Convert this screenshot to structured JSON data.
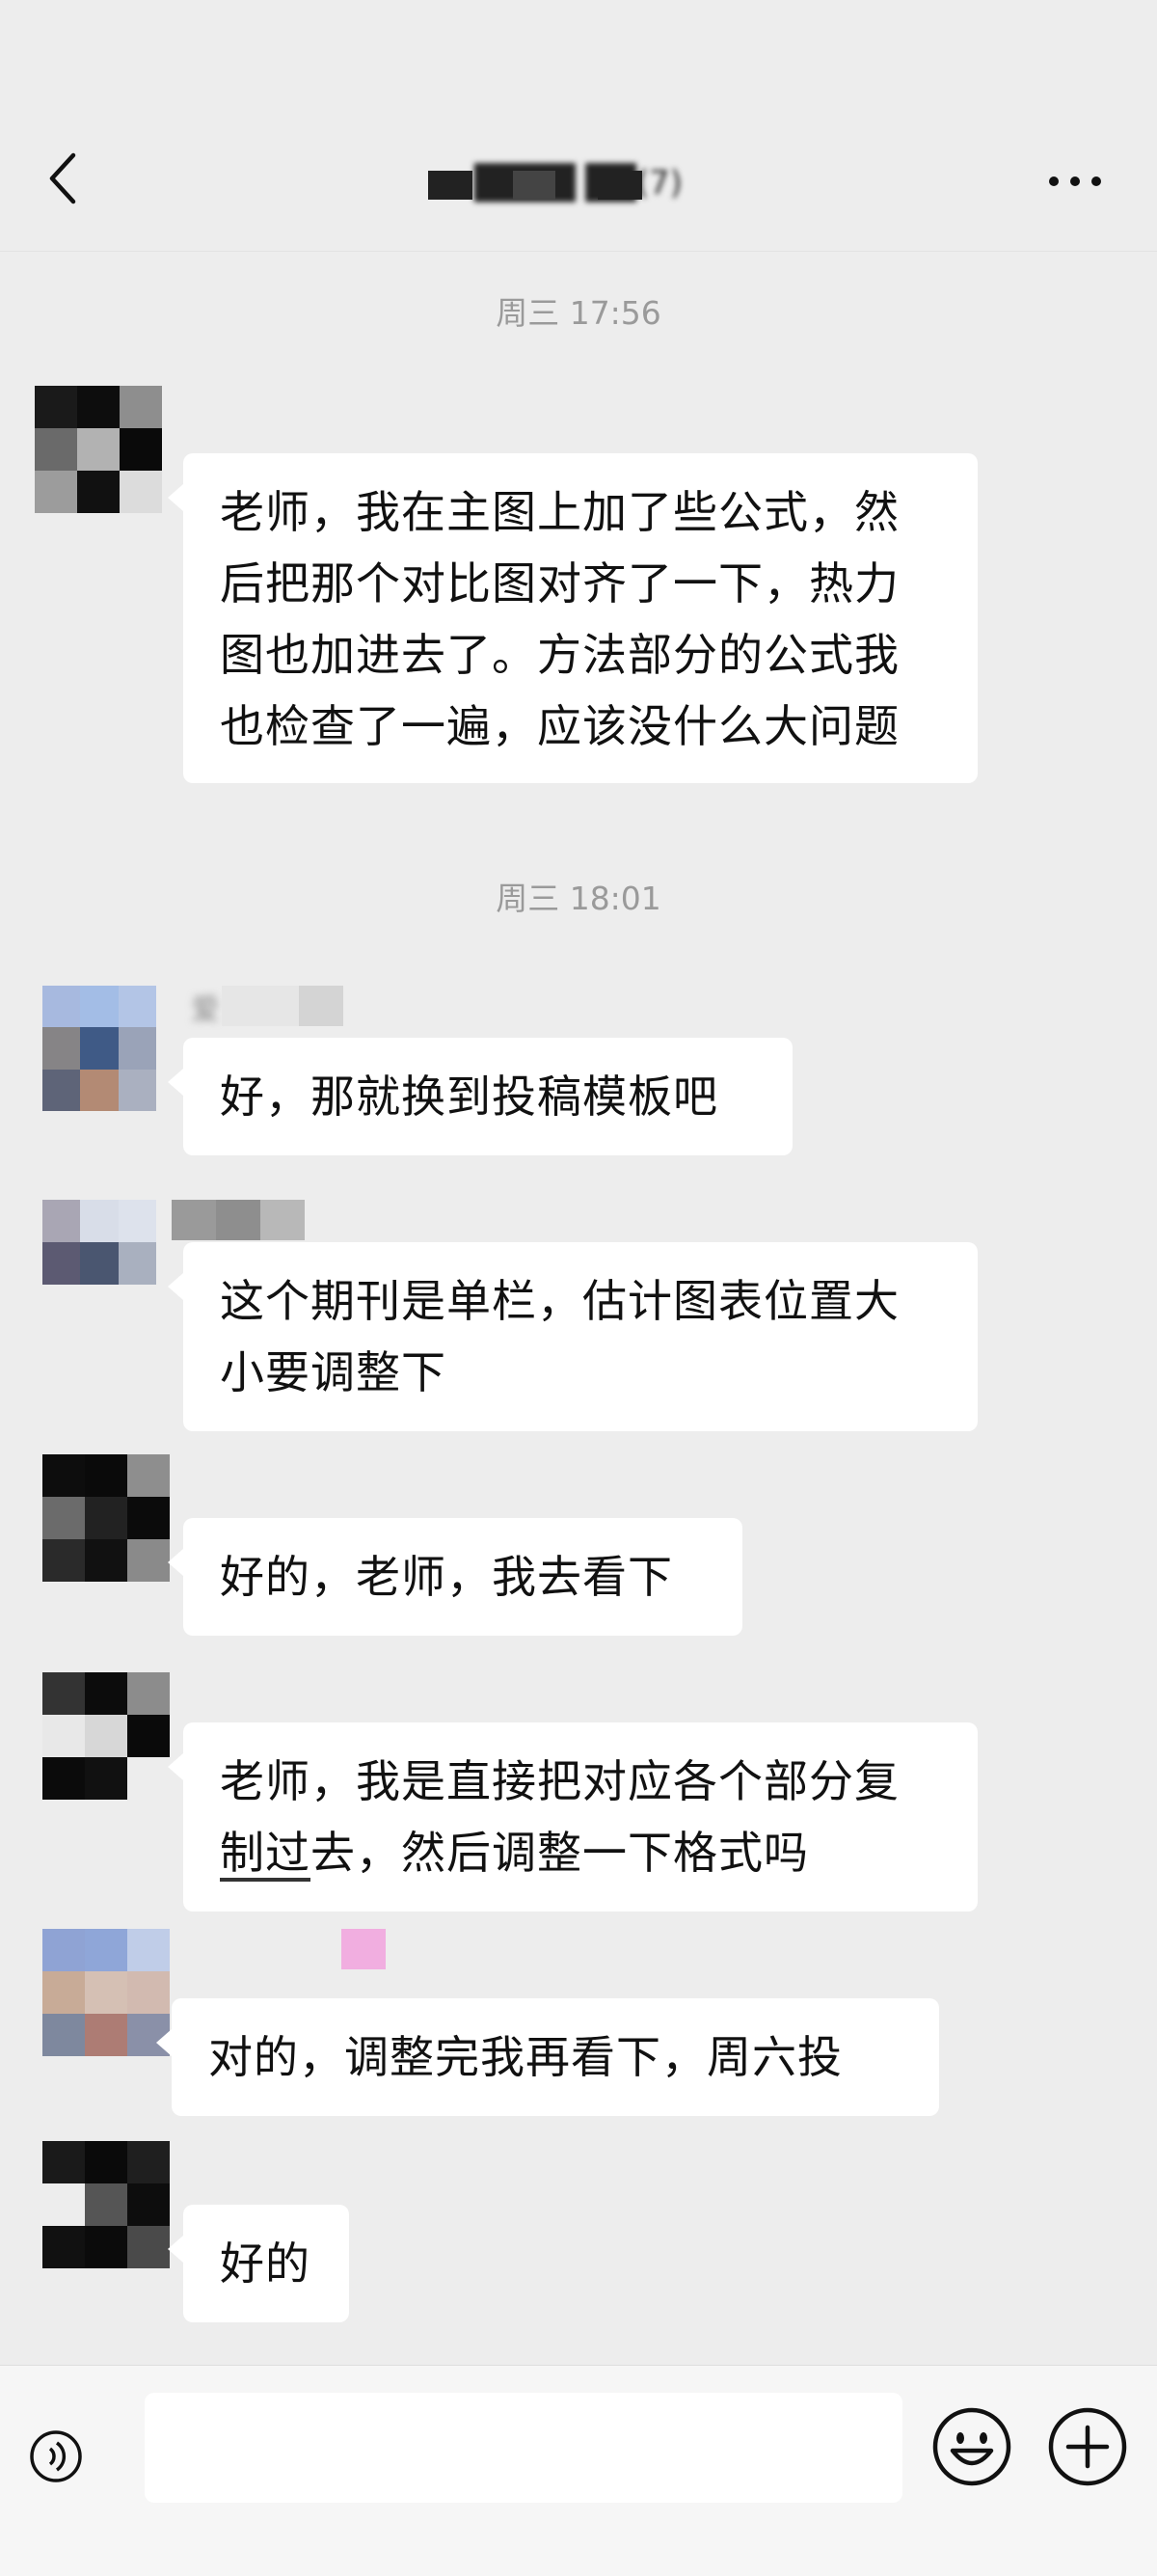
{
  "header": {
    "title": "████ ██(7)",
    "back_icon": "chevron-left-icon",
    "more_icon": "more-horizontal-icon"
  },
  "timestamps": [
    "周三 17:56",
    "周三 18:01"
  ],
  "messages": [
    {
      "text": "老师，我在主图上加了些公式，然后把那个对比图对齐了一下，热力图也加进去了。方法部分的公式我也检查了一遍，应该没什么大问题"
    },
    {
      "sender": "爱",
      "text": "好，那就换到投稿模板吧"
    },
    {
      "text": "这个期刊是单栏，估计图表位置大小要调整下"
    },
    {
      "text": "好的，老师，我去看下"
    },
    {
      "text_a": "老师，我是直接把对应各个部分复",
      "text_b": "制过",
      "text_c": "去，然后调整一下格式吗"
    },
    {
      "text": "对的，调整完我再看下，周六投"
    },
    {
      "text": "好的"
    }
  ],
  "input": {
    "placeholder": "",
    "value": ""
  },
  "toolbar": {
    "voice_icon": "voice-icon",
    "emoji_icon": "emoji-icon",
    "plus_icon": "plus-icon"
  }
}
